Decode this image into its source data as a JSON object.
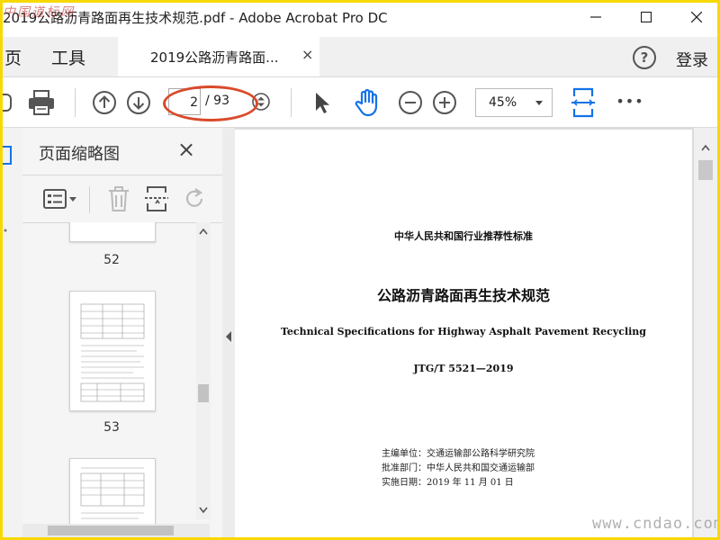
{
  "window": {
    "title": "2019公路沥青路面再生技术规范.pdf - Adobe Acrobat Pro DC",
    "watermark_top": "中国道标网"
  },
  "menu": {
    "home_partial": "页",
    "tools": "工具"
  },
  "tab": {
    "label": "2019公路沥青路面...",
    "close": "×"
  },
  "header_right": {
    "help": "?",
    "login": "登录"
  },
  "toolbar": {
    "page_current": "2",
    "page_total": "/ 93",
    "zoom": "45%",
    "more": "•••"
  },
  "thumbnail_panel": {
    "title": "页面缩略图",
    "close": "×",
    "thumbnails": [
      {
        "page_label": "52"
      },
      {
        "page_label": "53"
      }
    ]
  },
  "document": {
    "header_line": "中华人民共和国行业推荐性标准",
    "title_cn": "公路沥青路面再生技术规范",
    "title_en": "Technical Specifications for Highway Asphalt Pavement Recycling",
    "code": "JTG/T 5521—2019",
    "meta": [
      "主编单位：交通运输部公路科学研究院",
      "批准部门：中华人民共和国交通运输部",
      "实施日期：2019 年 11 月 01 日"
    ]
  },
  "watermark_bottom": "www.cndao.com",
  "colors": {
    "accent": "#1473e6",
    "highlight": "#d94a2a",
    "frame": "#f7d800"
  }
}
